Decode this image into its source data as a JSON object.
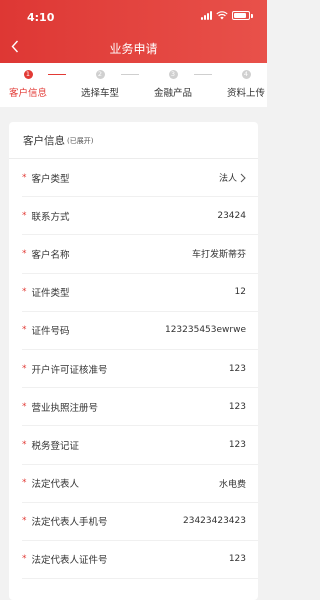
{
  "status_bar": {
    "time": "4:10"
  },
  "header": {
    "title": "业务申请"
  },
  "steps": [
    {
      "number": "1",
      "label": "客户信息",
      "active": true
    },
    {
      "number": "2",
      "label": "选择车型",
      "active": false
    },
    {
      "number": "3",
      "label": "金融产品",
      "active": false
    },
    {
      "number": "4",
      "label": "资料上传",
      "active": false
    }
  ],
  "card": {
    "title": "客户信息",
    "subtitle": "(已展开)",
    "required_mark": "*",
    "rows": [
      {
        "label": "客户类型",
        "value": "法人",
        "has_chevron": true
      },
      {
        "label": "联系方式",
        "value": "23424"
      },
      {
        "label": "客户名称",
        "value": "车打发斯蒂芬"
      },
      {
        "label": "证件类型",
        "value": "12"
      },
      {
        "label": "证件号码",
        "value": "123235453ewrwe"
      },
      {
        "label": "开户许可证核准号",
        "value": "123"
      },
      {
        "label": "营业执照注册号",
        "value": "123"
      },
      {
        "label": "税务登记证",
        "value": "123"
      },
      {
        "label": "法定代表人",
        "value": "水电费"
      },
      {
        "label": "法定代表人手机号",
        "value": "23423423423"
      },
      {
        "label": "法定代表人证件号",
        "value": "123"
      }
    ]
  },
  "colors": {
    "accent": "#e23a35",
    "header_start": "#de3734",
    "header_end": "#e8514a"
  }
}
